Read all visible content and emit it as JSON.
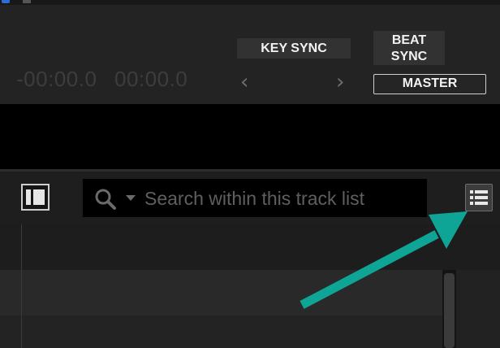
{
  "deck": {
    "time_remaining": "-00:00.0",
    "time_elapsed": "00:00.0",
    "key_sync_label": "KEY SYNC",
    "beat_sync_line1": "BEAT",
    "beat_sync_line2": "SYNC",
    "master_label": "MASTER",
    "prev_icon": "chevron-left-icon",
    "next_icon": "chevron-right-icon"
  },
  "toolbar": {
    "panel_toggle_icon": "panel-toggle-icon",
    "search_icon": "search-icon",
    "search_placeholder": "Search within this track list",
    "search_value": "",
    "list_view_icon": "list-view-icon"
  },
  "colors": {
    "annotation_arrow": "#0fa596",
    "background": "#1f1f1f",
    "waveform": "#000000"
  }
}
